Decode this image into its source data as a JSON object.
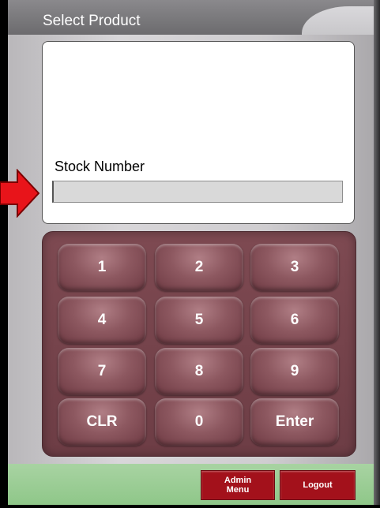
{
  "header": {
    "title": "Select Product"
  },
  "stock_field": {
    "label": "Stock Number",
    "value": "",
    "placeholder": ""
  },
  "keypad": {
    "keys": [
      "1",
      "2",
      "3",
      "4",
      "5",
      "6",
      "7",
      "8",
      "9",
      "CLR",
      "0",
      "Enter"
    ]
  },
  "footer": {
    "admin_menu_label": "Admin\nMenu",
    "logout_label": "Logout"
  },
  "colors": {
    "keypad_bg": "#6d3d45",
    "footer_bg": "#8fc789",
    "footer_button": "#a3111b",
    "arrow": "#e8141a"
  },
  "icons": {
    "pointer_arrow": "red-arrow-icon"
  }
}
